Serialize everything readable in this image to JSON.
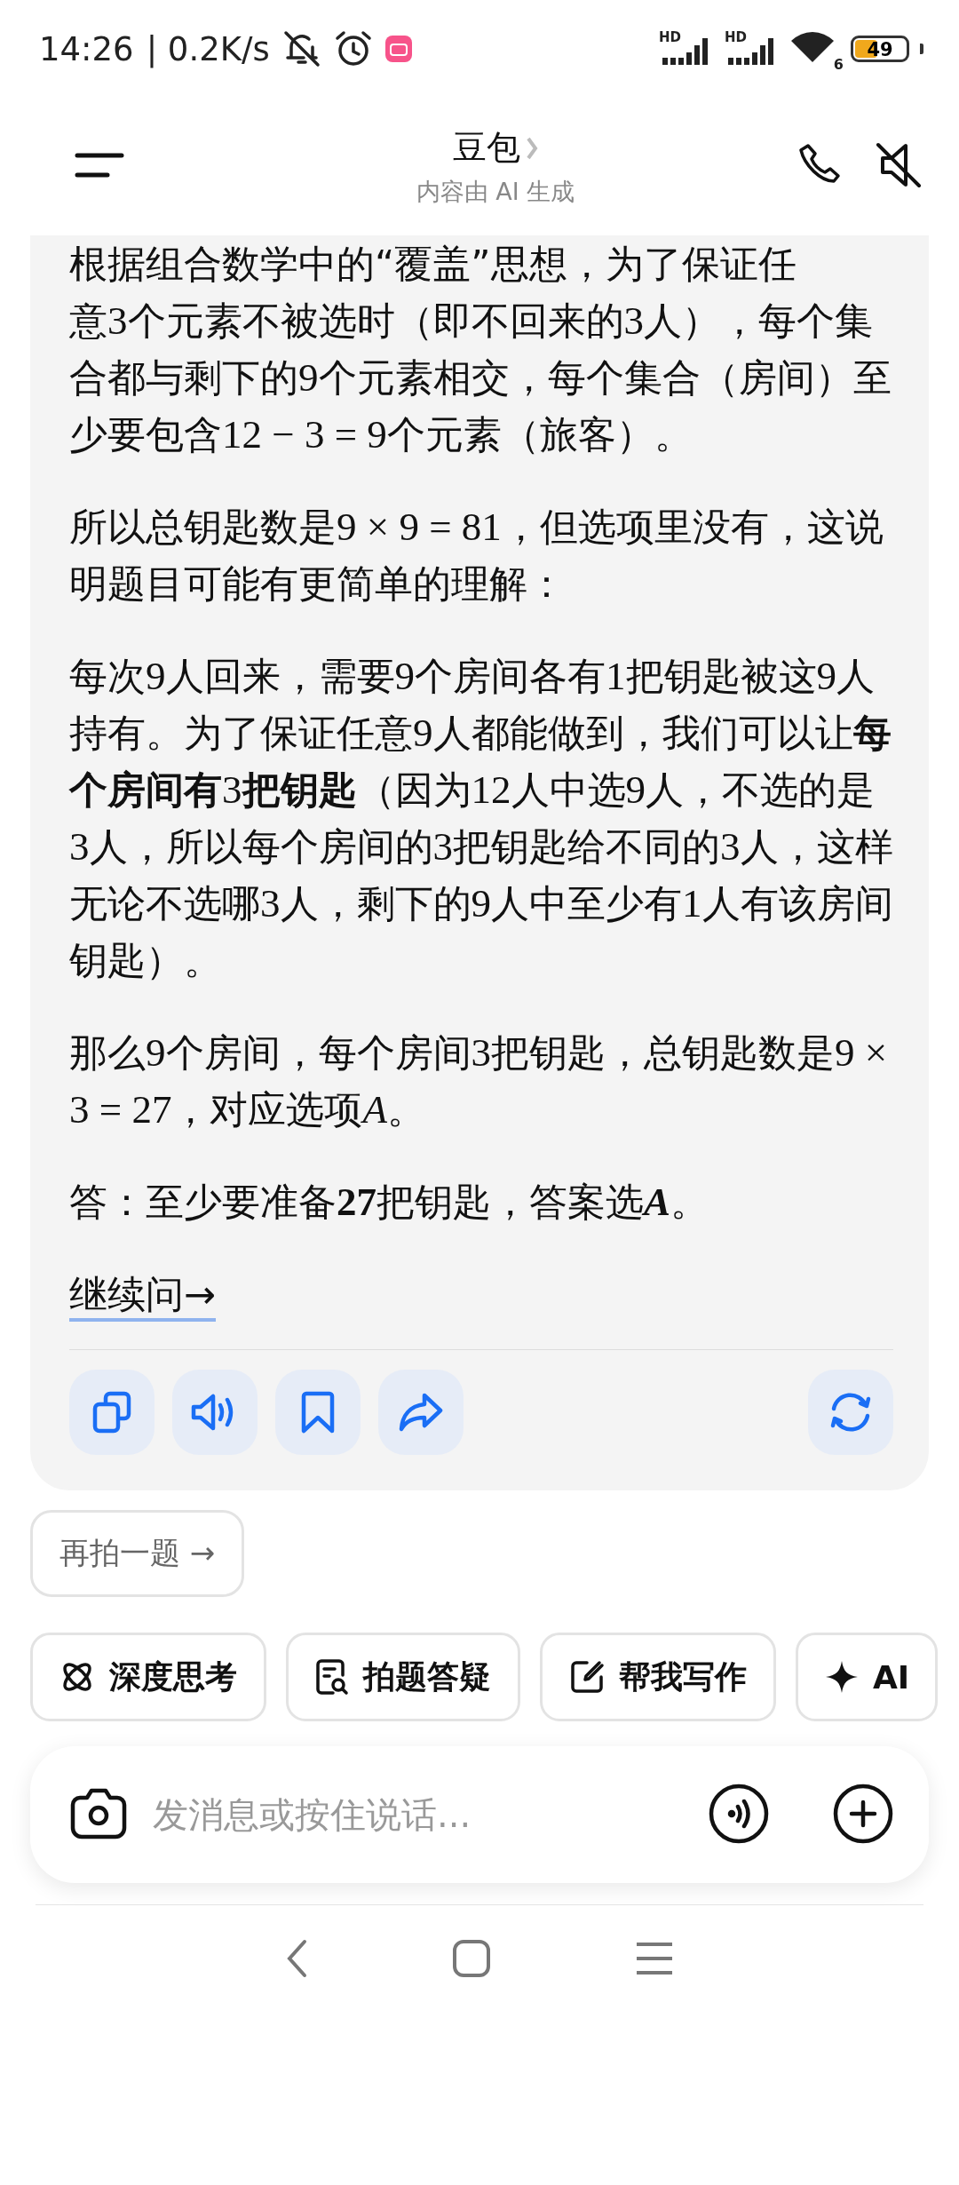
{
  "status_bar": {
    "time": "14:26",
    "speed": "| 0.2K/s",
    "signal_labels": [
      "HD",
      "HD"
    ],
    "wifi_label": "6",
    "battery": "49"
  },
  "header": {
    "title": "豆包",
    "subtitle": "内容由 AI 生成"
  },
  "message": {
    "cut_line": "根据组合数学中的“覆盖”思想，为了保证任",
    "paragraphs": [
      [
        {
          "kind": "text",
          "text": "意"
        },
        {
          "kind": "math",
          "text": "3"
        },
        {
          "kind": "text",
          "text": "个元素不被选时（即不回来的"
        },
        {
          "kind": "math",
          "text": "3"
        },
        {
          "kind": "text",
          "text": "人），每个集合都与剩下的"
        },
        {
          "kind": "math",
          "text": "9"
        },
        {
          "kind": "text",
          "text": "个元素相交，每个集合（房间）至少要包含"
        },
        {
          "kind": "math",
          "text": "12 − 3 = 9"
        },
        {
          "kind": "text",
          "text": "个元素（旅客）。"
        }
      ],
      [
        {
          "kind": "text",
          "text": "所以总钥匙数是"
        },
        {
          "kind": "math",
          "text": "9 × 9 = 81"
        },
        {
          "kind": "text",
          "text": "，但选项里没有，这说明题目可能有更简单的理解："
        }
      ],
      [
        {
          "kind": "text",
          "text": "每次"
        },
        {
          "kind": "math",
          "text": "9"
        },
        {
          "kind": "text",
          "text": "人回来，需要"
        },
        {
          "kind": "math",
          "text": "9"
        },
        {
          "kind": "text",
          "text": "个房间各有"
        },
        {
          "kind": "math",
          "text": "1"
        },
        {
          "kind": "text",
          "text": "把钥匙被这"
        },
        {
          "kind": "math",
          "text": "9"
        },
        {
          "kind": "text",
          "text": "人持有。为了保证任意"
        },
        {
          "kind": "math",
          "text": "9"
        },
        {
          "kind": "text",
          "text": "人都能做到，我们可以让"
        },
        {
          "kind": "bold",
          "text": "每个房间有"
        },
        {
          "kind": "math",
          "text": "3"
        },
        {
          "kind": "bold",
          "text": "把钥匙"
        },
        {
          "kind": "text",
          "text": "（因为"
        },
        {
          "kind": "math",
          "text": "12"
        },
        {
          "kind": "text",
          "text": "人中选"
        },
        {
          "kind": "math",
          "text": "9"
        },
        {
          "kind": "text",
          "text": "人，不选的是"
        },
        {
          "kind": "math",
          "text": "3"
        },
        {
          "kind": "text",
          "text": "人，所以每个房间的"
        },
        {
          "kind": "math",
          "text": "3"
        },
        {
          "kind": "text",
          "text": "把钥匙给不同的"
        },
        {
          "kind": "math",
          "text": "3"
        },
        {
          "kind": "text",
          "text": "人，这样无论不选哪"
        },
        {
          "kind": "math",
          "text": "3"
        },
        {
          "kind": "text",
          "text": "人，剩下的"
        },
        {
          "kind": "math",
          "text": "9"
        },
        {
          "kind": "text",
          "text": "人中至少有"
        },
        {
          "kind": "math",
          "text": "1"
        },
        {
          "kind": "text",
          "text": "人有该房间钥匙）。"
        }
      ],
      [
        {
          "kind": "text",
          "text": "那么"
        },
        {
          "kind": "math",
          "text": "9"
        },
        {
          "kind": "text",
          "text": "个房间，每个房间"
        },
        {
          "kind": "math",
          "text": "3"
        },
        {
          "kind": "text",
          "text": "把钥匙，总钥匙数是"
        },
        {
          "kind": "math",
          "text": "9 × 3 = 27"
        },
        {
          "kind": "text",
          "text": "，对应选项"
        },
        {
          "kind": "math",
          "text": "*A*"
        },
        {
          "kind": "text",
          "text": "。"
        }
      ],
      [
        {
          "kind": "text",
          "text": "答：至少要准备"
        },
        {
          "kind": "bold_math",
          "text": "27"
        },
        {
          "kind": "text",
          "text": "把钥匙，答案选"
        },
        {
          "kind": "bold_math",
          "text": "*A*"
        },
        {
          "kind": "text",
          "text": "。"
        }
      ]
    ],
    "link": "继续问→",
    "actions": [
      {
        "kind": "copy"
      },
      {
        "kind": "speaker"
      },
      {
        "kind": "bookmark"
      },
      {
        "kind": "share"
      },
      {
        "kind": "refresh"
      }
    ]
  },
  "retake_button": "再拍一题 →",
  "chips": [
    {
      "kind": "atom",
      "label": "深度思考"
    },
    {
      "kind": "doc_search",
      "label": "拍题答疑"
    },
    {
      "kind": "edit",
      "label": "帮我写作"
    },
    {
      "kind": "sparkle",
      "label": "AI"
    }
  ],
  "input": {
    "placeholder": "发消息或按住说话..."
  }
}
